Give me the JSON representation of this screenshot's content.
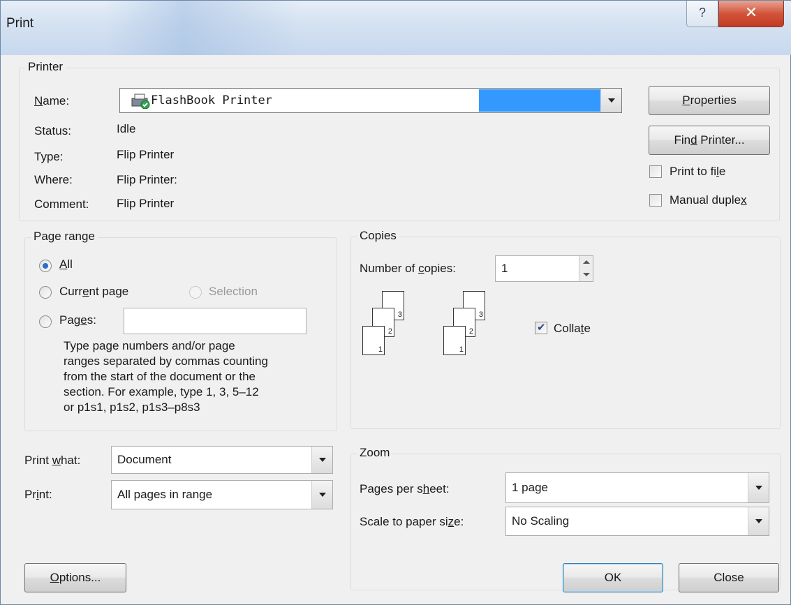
{
  "window": {
    "title": "Print",
    "help_glyph": "?",
    "close_glyph": "✕"
  },
  "printer": {
    "legend": "Printer",
    "name_label_n": "N",
    "name_label_rest": "ame:",
    "name_value": "FlashBook Printer",
    "status_label": "Status:",
    "status_value": "Idle",
    "type_label": "Type:",
    "type_value": "Flip Printer",
    "where_label": "Where:",
    "where_value": "Flip Printer:",
    "comment_label": "Comment:",
    "comment_value": "Flip Printer",
    "properties_p": "P",
    "properties_rest": "roperties",
    "find_pre": "Fin",
    "find_d": "d",
    "find_rest": " Printer...",
    "print_to_file_pre": "Print to fi",
    "print_to_file_l": "l",
    "print_to_file_rest": "e",
    "print_to_file_checked": false,
    "manual_duplex_pre": "Manual duple",
    "manual_duplex_x": "x",
    "manual_duplex_checked": false
  },
  "page_range": {
    "legend": "Page range",
    "all_a": "A",
    "all_rest": "ll",
    "current_pre": "Curr",
    "current_e": "e",
    "current_rest": "nt page",
    "selection": "Selection",
    "pages_pre": "Pag",
    "pages_e": "e",
    "pages_rest": "s:",
    "pages_value": "",
    "hint_lines": [
      "Type page numbers and/or page",
      "ranges separated by commas counting",
      "from the start of the document or the",
      "section. For example, type 1, 3, 5–12",
      "or p1s1, p1s2, p1s3–p8s3"
    ],
    "selected": "All"
  },
  "print_what": {
    "label_pre": "Print ",
    "label_w": "w",
    "label_rest": "hat:",
    "value": "Document"
  },
  "print_select": {
    "label_pre": "Pr",
    "label_i": "i",
    "label_rest": "nt:",
    "value": "All pages in range"
  },
  "copies": {
    "legend": "Copies",
    "number_pre": "Number of ",
    "number_c": "c",
    "number_rest": "opies:",
    "number_value": "1",
    "collate_pre": "Colla",
    "collate_t": "t",
    "collate_rest": "e",
    "collate_checked": true,
    "page_nums": [
      "3",
      "2",
      "1"
    ]
  },
  "zoom": {
    "legend": "Zoom",
    "pps_pre": "Pages per s",
    "pps_h": "h",
    "pps_rest": "eet:",
    "pps_value": "1 page",
    "scale_pre": "Scale to paper si",
    "scale_z": "z",
    "scale_rest": "e:",
    "scale_value": "No Scaling"
  },
  "buttons": {
    "options_o": "O",
    "options_rest": "ptions...",
    "ok": "OK",
    "close": "Close"
  }
}
